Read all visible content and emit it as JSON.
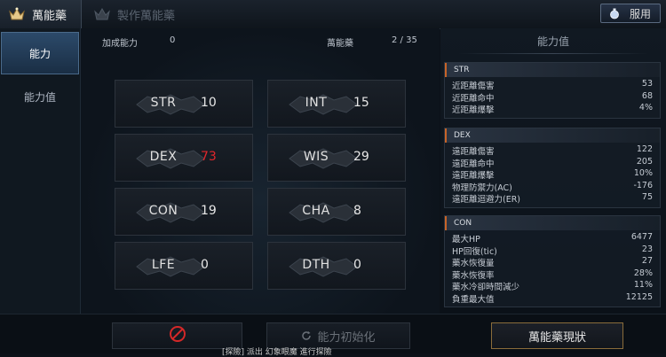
{
  "tabs": [
    {
      "label": "萬能藥",
      "icon": "crown-icon"
    },
    {
      "label": "製作萬能藥",
      "icon": "crown-icon"
    }
  ],
  "use_button": {
    "label": "服用",
    "icon": "potion-icon"
  },
  "sidebar": {
    "items": [
      {
        "label": "能力"
      },
      {
        "label": "能力值"
      }
    ]
  },
  "header": {
    "bonus_label": "加成能力",
    "bonus_value": "0",
    "elixir_label": "萬能藥",
    "elixir_count": "2 / 35"
  },
  "stats": [
    {
      "name": "STR",
      "value": "10",
      "highlight": false
    },
    {
      "name": "INT",
      "value": "15",
      "highlight": false
    },
    {
      "name": "DEX",
      "value": "73",
      "highlight": true
    },
    {
      "name": "WIS",
      "value": "29",
      "highlight": false
    },
    {
      "name": "CON",
      "value": "19",
      "highlight": false
    },
    {
      "name": "CHA",
      "value": "8",
      "highlight": false
    },
    {
      "name": "LFE",
      "value": "0",
      "highlight": false
    },
    {
      "name": "DTH",
      "value": "0",
      "highlight": false
    }
  ],
  "panel": {
    "title": "能力值",
    "sections": [
      {
        "name": "STR",
        "rows": [
          {
            "label": "近距離傷害",
            "value": "53"
          },
          {
            "label": "近距離命中",
            "value": "68"
          },
          {
            "label": "近距離爆擊",
            "value": "4%"
          }
        ]
      },
      {
        "name": "DEX",
        "rows": [
          {
            "label": "遠距離傷害",
            "value": "122"
          },
          {
            "label": "遠距離命中",
            "value": "205"
          },
          {
            "label": "遠距離爆擊",
            "value": "10%"
          },
          {
            "label": "物理防禦力(AC)",
            "value": "-176"
          },
          {
            "label": "遠距離迴避力(ER)",
            "value": "75"
          }
        ]
      },
      {
        "name": "CON",
        "rows": [
          {
            "label": "最大HP",
            "value": "6477"
          },
          {
            "label": "HP回復(tic)",
            "value": "23"
          },
          {
            "label": "藥水恢復量",
            "value": "27"
          },
          {
            "label": "藥水恢復率",
            "value": "28%"
          },
          {
            "label": "藥水冷卻時間減少",
            "value": "11%"
          },
          {
            "label": "負重最大值",
            "value": "12125"
          }
        ]
      }
    ]
  },
  "bottom": {
    "reset_label": "能力初始化",
    "current_label": "萬能藥現狀",
    "notice": "[探險] 派出 幻象眼魔 進行探險"
  },
  "colors": {
    "accent_orange": "#c86428",
    "highlight_red": "#e0262b",
    "gold_border": "#8a6c3a"
  }
}
